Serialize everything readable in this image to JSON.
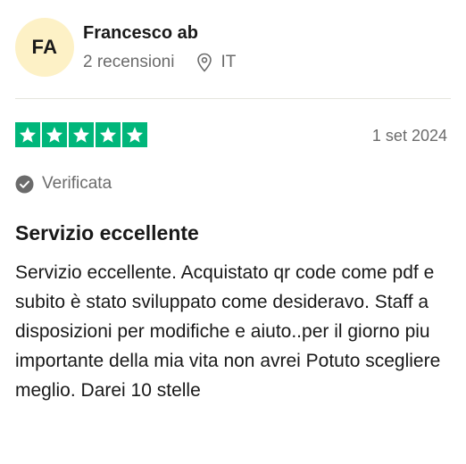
{
  "reviewer": {
    "initials": "FA",
    "name": "Francesco ab",
    "reviews_count": "2 recensioni",
    "country": "IT"
  },
  "review": {
    "rating": 5,
    "rating_max": 5,
    "date": "1 set 2024",
    "verified_label": "Verificata",
    "title": "Servizio eccellente",
    "body": "Servizio eccellente. Acquistato qr code come pdf e subito è stato sviluppato come desideravo. Staff a disposizioni per modifiche e aiuto..per il giorno piu importante della mia vita non avrei Potuto scegliere meglio. Darei 10 stelle"
  },
  "icons": {
    "location": "location-pin-icon",
    "verified": "check-circle-icon",
    "star": "star-icon"
  },
  "colors": {
    "star_green": "#00b67a",
    "avatar_bg": "#fdf1c6",
    "muted_text": "#6b6b6b"
  }
}
